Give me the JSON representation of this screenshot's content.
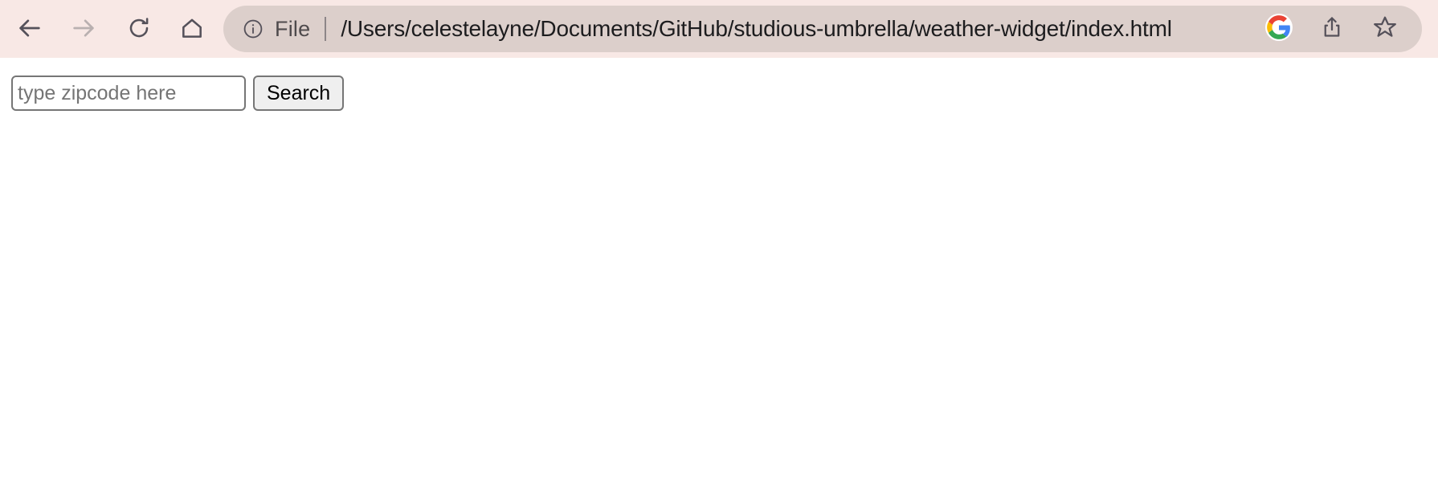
{
  "browser": {
    "toolbar": {
      "background_color": "#f8e8e5",
      "nav": [
        {
          "name": "back",
          "icon": "back-arrow-icon",
          "label": "Back",
          "enabled": true
        },
        {
          "name": "forward",
          "icon": "forward-arrow-icon",
          "label": "Forward",
          "enabled": false
        },
        {
          "name": "reload",
          "icon": "reload-icon",
          "label": "Reload",
          "enabled": true
        },
        {
          "name": "home",
          "icon": "home-icon",
          "label": "Home",
          "enabled": true
        }
      ]
    },
    "address_bar": {
      "background_color": "#dccfcb",
      "site_info_icon": "info-circle-icon",
      "scheme_label": "File",
      "url": "/Users/celestelayne/Documents/GitHub/studious-umbrella/weather-widget/index.html",
      "actions": [
        {
          "name": "google-account",
          "icon": "google-g-icon",
          "label": "Google account"
        },
        {
          "name": "share",
          "icon": "share-icon",
          "label": "Share"
        },
        {
          "name": "bookmark",
          "icon": "star-icon",
          "label": "Bookmark this page"
        }
      ]
    }
  },
  "page": {
    "background_color": "#ffffff",
    "form": {
      "zipcode_input": {
        "placeholder": "type zipcode here",
        "value": ""
      },
      "search_button": {
        "label": "Search"
      }
    }
  },
  "colors": {
    "toolbar_bg": "#f8e8e5",
    "pill_bg": "#dccfcb",
    "icon_active": "#55515a",
    "icon_disabled": "#b9b0b0",
    "url_text": "#1c1c1e",
    "scheme_text": "#4e4a4c",
    "input_border": "#767676",
    "button_bg": "#efefef",
    "placeholder_text": "#757575",
    "google_red": "#ea4335",
    "google_yellow": "#fbbc05",
    "google_green": "#34a853",
    "google_blue": "#4285f4"
  }
}
